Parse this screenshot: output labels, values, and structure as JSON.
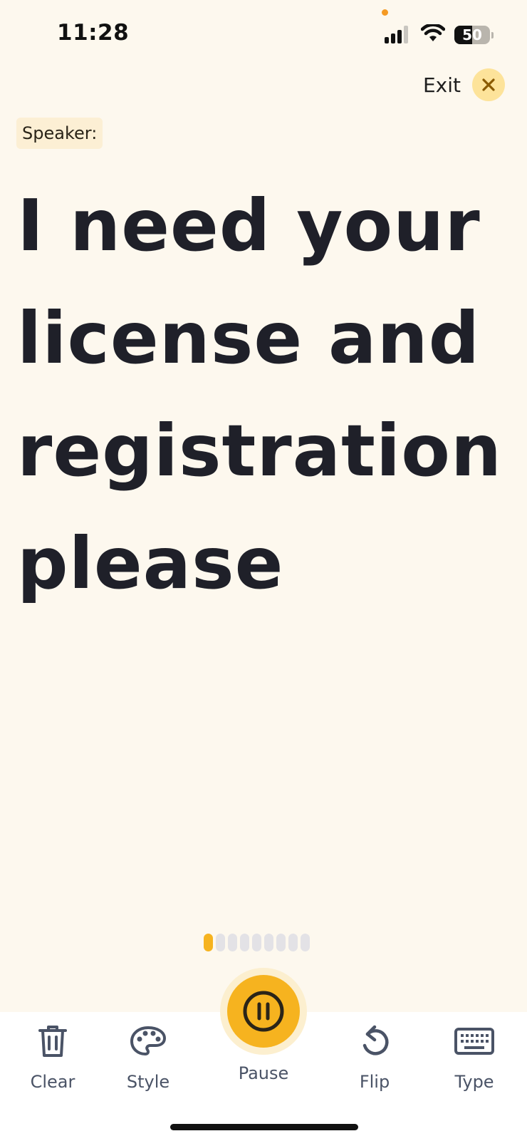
{
  "status_bar": {
    "time": "11:28",
    "battery_level": "50",
    "battery_fraction": 0.5,
    "signal_icon": "cellular-signal-icon",
    "wifi_icon": "wifi-icon"
  },
  "header": {
    "exit_label": "Exit",
    "exit_icon": "close-icon"
  },
  "speaker": {
    "label": "Speaker:"
  },
  "transcript": {
    "lines": [
      "I need your",
      "license and",
      "registration",
      "please"
    ]
  },
  "pager": {
    "total": 9,
    "active_index": 0
  },
  "toolbar": {
    "clear_label": "Clear",
    "style_label": "Style",
    "pause_label": "Pause",
    "flip_label": "Flip",
    "type_label": "Type"
  },
  "colors": {
    "background": "#fdf8ee",
    "accent": "#f6b31f",
    "text": "#1f2029",
    "icon": "#4a5366"
  }
}
